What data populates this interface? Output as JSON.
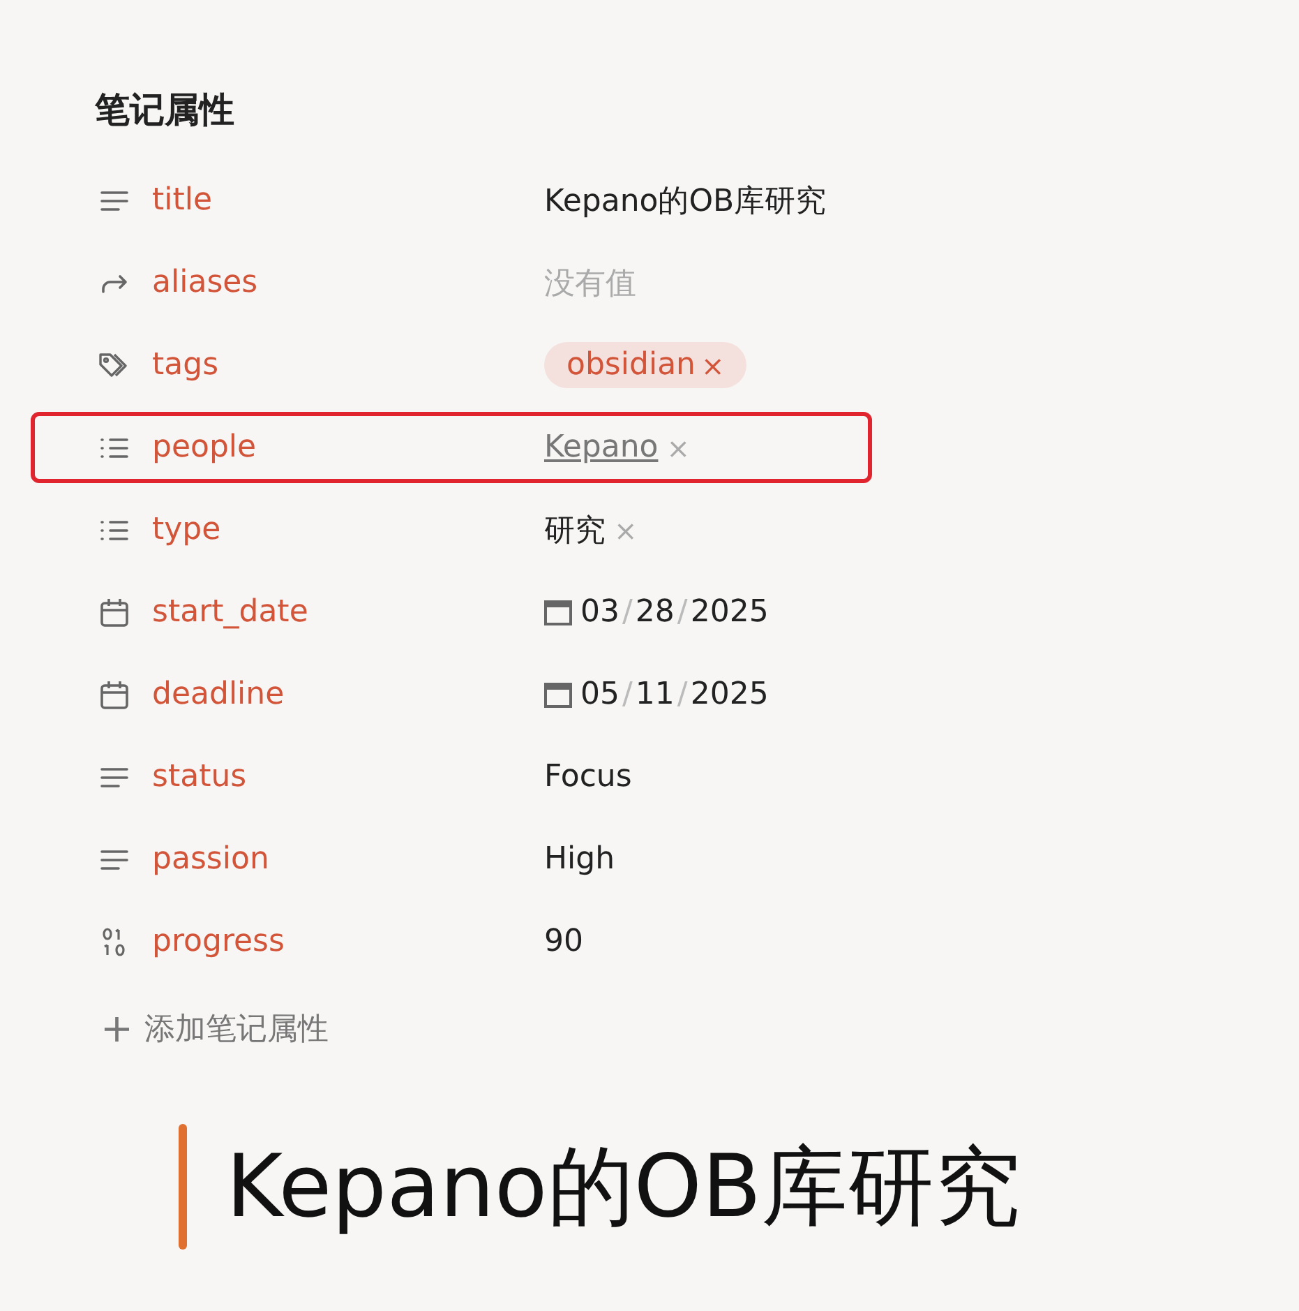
{
  "properties_heading": "笔记属性",
  "properties": [
    {
      "key": "title",
      "kind": "text",
      "value": "Kepano的OB库研究",
      "highlighted": false
    },
    {
      "key": "aliases",
      "kind": "aliases",
      "placeholder": "没有值",
      "highlighted": false
    },
    {
      "key": "tags",
      "kind": "tags",
      "items": [
        {
          "label": "obsidian",
          "remove": "×"
        }
      ],
      "highlighted": false
    },
    {
      "key": "people",
      "kind": "list",
      "items": [
        {
          "label": "Kepano",
          "remove": "×",
          "link": true
        }
      ],
      "highlighted": true
    },
    {
      "key": "type",
      "kind": "list",
      "items": [
        {
          "label": "研究",
          "remove": "×",
          "link": false
        }
      ],
      "highlighted": false
    },
    {
      "key": "start_date",
      "kind": "date",
      "value": "03/28/2025",
      "highlighted": false
    },
    {
      "key": "deadline",
      "kind": "date",
      "value": "05/11/2025",
      "highlighted": false
    },
    {
      "key": "status",
      "kind": "text",
      "value": "Focus",
      "highlighted": false
    },
    {
      "key": "passion",
      "kind": "text",
      "value": "High",
      "highlighted": false
    },
    {
      "key": "progress",
      "kind": "number",
      "value": "90",
      "highlighted": false
    }
  ],
  "add_property": {
    "icon": "+",
    "label": "添加笔记属性"
  },
  "note_title": "Kepano的OB库研究"
}
